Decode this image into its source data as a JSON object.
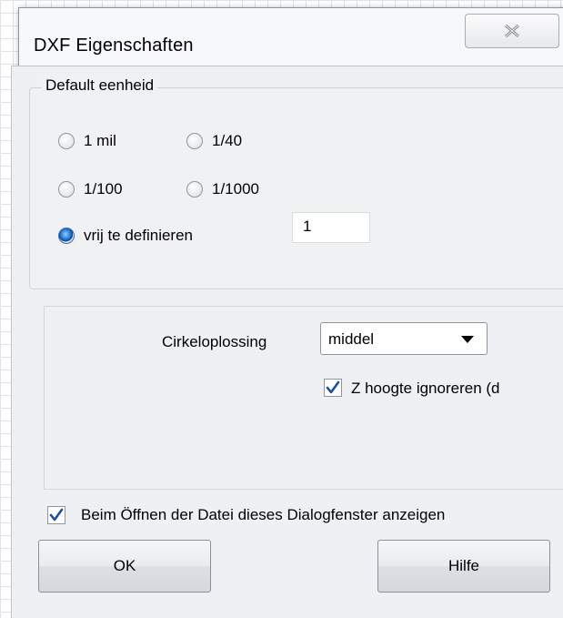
{
  "window": {
    "title": "DXF Eigenschaften"
  },
  "unit_group": {
    "legend": "Default eenheid",
    "options": [
      {
        "label": "1 mil",
        "checked": false
      },
      {
        "label": "1/40",
        "checked": false
      },
      {
        "label": "1/100",
        "checked": false
      },
      {
        "label": "1/1000",
        "checked": false
      },
      {
        "label": "vrij te definieren",
        "checked": true
      }
    ],
    "custom_value": "1"
  },
  "settings": {
    "cirkel_label": "Cirkeloplossing",
    "cirkel_selected": "middel",
    "z_ignore_label": "Z hoogte ignoreren (d",
    "z_ignore_checked": true
  },
  "footer": {
    "show_dialog_label": "Beim Öffnen der Datei dieses Dialogfenster anzeigen",
    "show_dialog_checked": true,
    "ok_label": "OK",
    "help_label": "Hilfe"
  },
  "icons": {
    "close": "close-x-icon",
    "check": "checkmark-icon",
    "dropdown": "triangle-down-icon"
  }
}
